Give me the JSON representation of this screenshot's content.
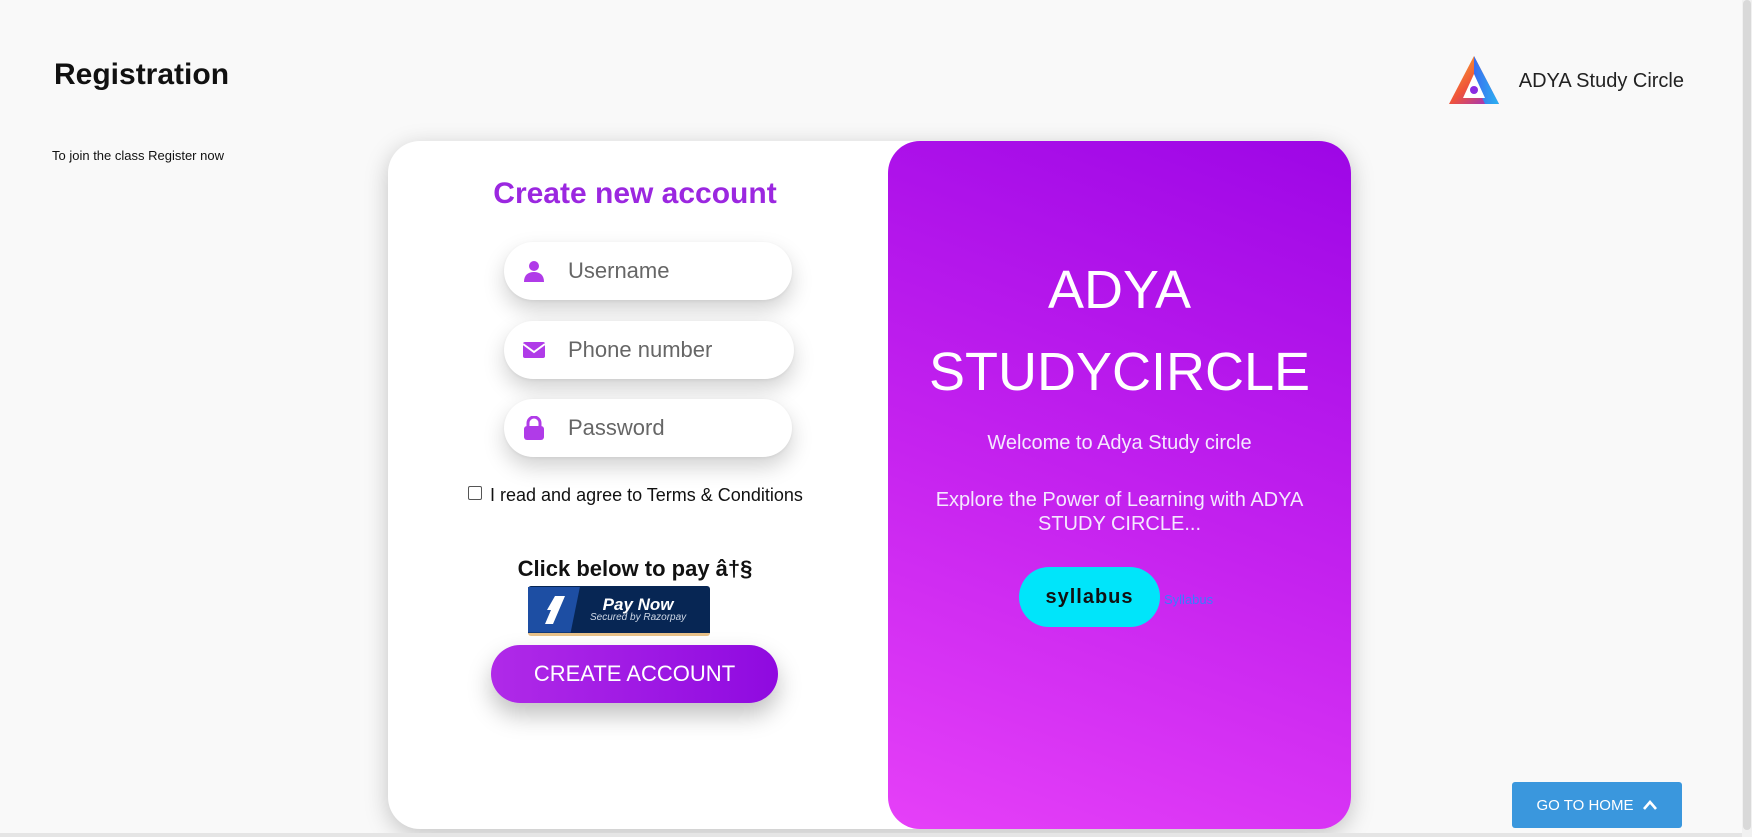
{
  "page": {
    "title": "Registration",
    "subtitle": "To join the class Register now"
  },
  "brand": {
    "name": "ADYA Study Circle",
    "logo_icon": "adya-triangle-logo-icon"
  },
  "form": {
    "title": "Create new account",
    "username_placeholder": "Username",
    "phone_placeholder": "Phone number",
    "password_placeholder": "Password",
    "terms_label": "I read and agree to Terms & Conditions",
    "terms_checked": false,
    "pay_label": "Click below to pay â†§",
    "pay_button": {
      "title": "Pay Now",
      "subtitle": "Secured by Razorpay"
    },
    "submit_label": "CREATE ACCOUNT"
  },
  "hero": {
    "title": "ADYA STUDYCIRCLE",
    "welcome": "Welcome to Adya Study circle",
    "tagline": "Explore the Power of Learning with ADYA STUDY CIRCLE...",
    "syllabus_button": "syllabus",
    "syllabus_link": "Syllabus"
  },
  "footer": {
    "home_button": "GO TO HOME"
  },
  "colors": {
    "accent": "#9b27e0",
    "hero_gradient_start": "#e640f8",
    "hero_gradient_end": "#9d06e6",
    "syllabus_button": "#00e5fa",
    "home_button": "#3a97dd",
    "razorpay_navy": "#072654"
  }
}
